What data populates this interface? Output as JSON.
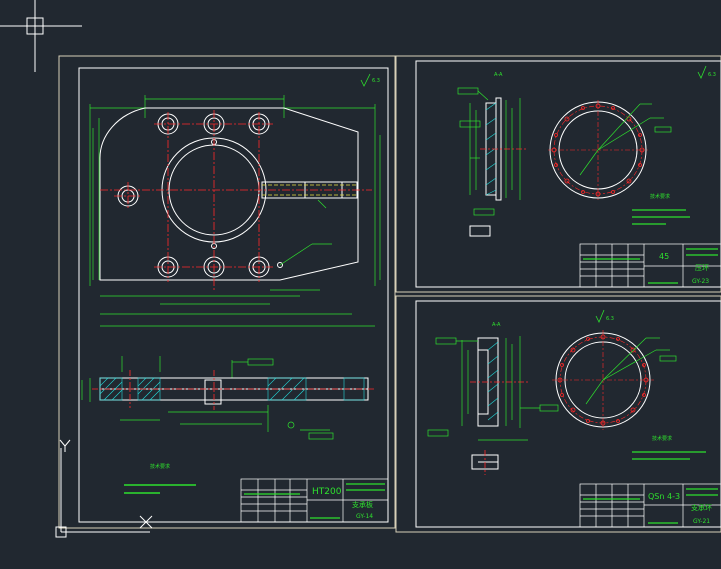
{
  "colors": {
    "background": "#212830",
    "frame": "#d8d0b8",
    "geometry": "#ffffff",
    "dimension": "#2ee02e",
    "centerline": "#ff2a2a",
    "hatch": "#23d6d6",
    "crosshair": "#ffffff"
  },
  "sheets": [
    {
      "id": "sheet-left",
      "roughness": "6.3",
      "material": "HT200",
      "part_name": "支承板",
      "drawing_no": "GY-14",
      "notes_title": "技术要求"
    },
    {
      "id": "sheet-top-right",
      "section_label": "A-A",
      "roughness": "6.3",
      "material": "45",
      "part_name": "压环",
      "drawing_no": "GY-23",
      "notes_title": "技术要求"
    },
    {
      "id": "sheet-bottom-right",
      "section_label": "A-A",
      "roughness": "6.3",
      "material": "QSn 4-3",
      "part_name": "支承环",
      "drawing_no": "GY-21",
      "notes_title": "技术要求"
    }
  ],
  "ucs": {
    "y_label": "Y",
    "x_label": "X"
  }
}
